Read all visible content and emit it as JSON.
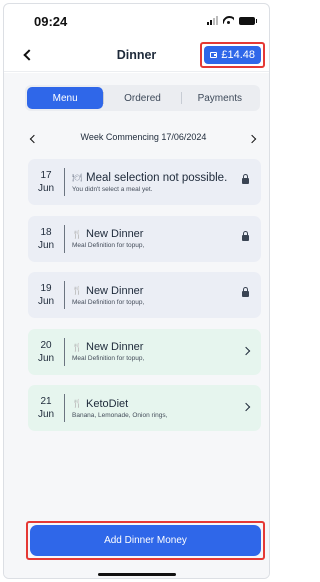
{
  "status_bar": {
    "time": "09:24"
  },
  "header": {
    "title": "Dinner",
    "balance": "£14.48"
  },
  "tabs": [
    {
      "label": "Menu",
      "active": true
    },
    {
      "label": "Ordered",
      "active": false
    },
    {
      "label": "Payments",
      "active": false
    }
  ],
  "week": {
    "label": "Week Commencing 17/06/2024"
  },
  "days": [
    {
      "day": "17",
      "month": "Jun",
      "title": "Meal selection not possible.",
      "subtitle": "You didn't select a meal yet.",
      "status": "locked",
      "icon": "dish-icon"
    },
    {
      "day": "18",
      "month": "Jun",
      "title": "New Dinner",
      "subtitle": "Meal Definition for topup,",
      "status": "locked",
      "icon": "cutlery-icon"
    },
    {
      "day": "19",
      "month": "Jun",
      "title": "New Dinner",
      "subtitle": "Meal Definition for topup,",
      "status": "locked",
      "icon": "cutlery-icon"
    },
    {
      "day": "20",
      "month": "Jun",
      "title": "New Dinner",
      "subtitle": "Meal Definition for topup,",
      "status": "open",
      "icon": "cutlery-icon"
    },
    {
      "day": "21",
      "month": "Jun",
      "title": "KetoDiet",
      "subtitle": "Banana, Lemonade, Onion rings,",
      "status": "open",
      "icon": "cutlery-icon"
    }
  ],
  "cta": {
    "label": "Add Dinner Money"
  },
  "colors": {
    "primary": "#2f67e9",
    "highlight": "#e53935",
    "open_card": "#e6f5ee",
    "locked_card": "#ebeef5"
  }
}
